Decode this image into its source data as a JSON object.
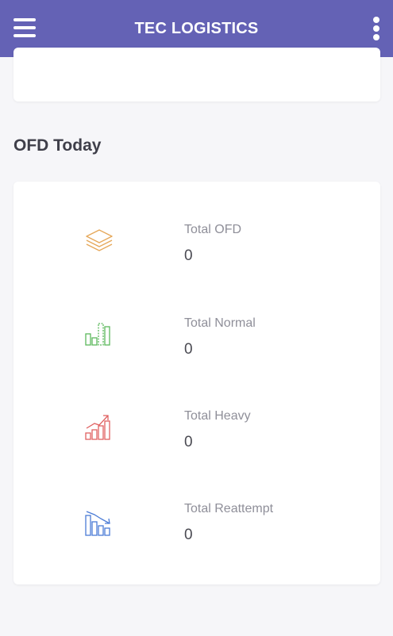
{
  "header": {
    "title": "TEC LOGISTICS",
    "menu_icon": "hamburger-menu-icon",
    "more_icon": "vertical-dots-icon",
    "background_color": "#6462b5"
  },
  "section": {
    "title": "OFD Today"
  },
  "stats": [
    {
      "label": "Total OFD",
      "value": "0",
      "icon": "layers-icon",
      "color": "#e6a85a"
    },
    {
      "label": "Total Normal",
      "value": "0",
      "icon": "bar-chart-icon",
      "color": "#5cb85c"
    },
    {
      "label": "Total Heavy",
      "value": "0",
      "icon": "trending-up-chart-icon",
      "color": "#e06060"
    },
    {
      "label": "Total Reattempt",
      "value": "0",
      "icon": "trending-down-chart-icon",
      "color": "#4a7bd6"
    }
  ]
}
